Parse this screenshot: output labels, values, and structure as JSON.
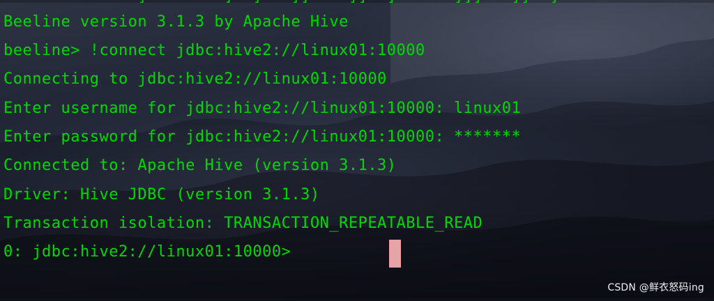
{
  "terminal": {
    "cut_line": "              ]        ]  ]   ]]    ]]  ]      ]]]   ]]  ]",
    "lines": [
      "Beeline version 3.1.3 by Apache Hive",
      "beeline> !connect jdbc:hive2://linux01:10000",
      "Connecting to jdbc:hive2://linux01:10000",
      "Enter username for jdbc:hive2://linux01:10000: linux01",
      "Enter password for jdbc:hive2://linux01:10000: *******",
      "Connected to: Apache Hive (version 3.1.3)",
      "Driver: Hive JDBC (version 3.1.3)",
      "Transaction isolation: TRANSACTION_REPEATABLE_READ",
      "0: jdbc:hive2://linux01:10000> "
    ],
    "text_color": "#00d100",
    "cursor_color": "#e8a4a4"
  },
  "watermark": {
    "text": "CSDN @鲜衣怒码ing"
  }
}
